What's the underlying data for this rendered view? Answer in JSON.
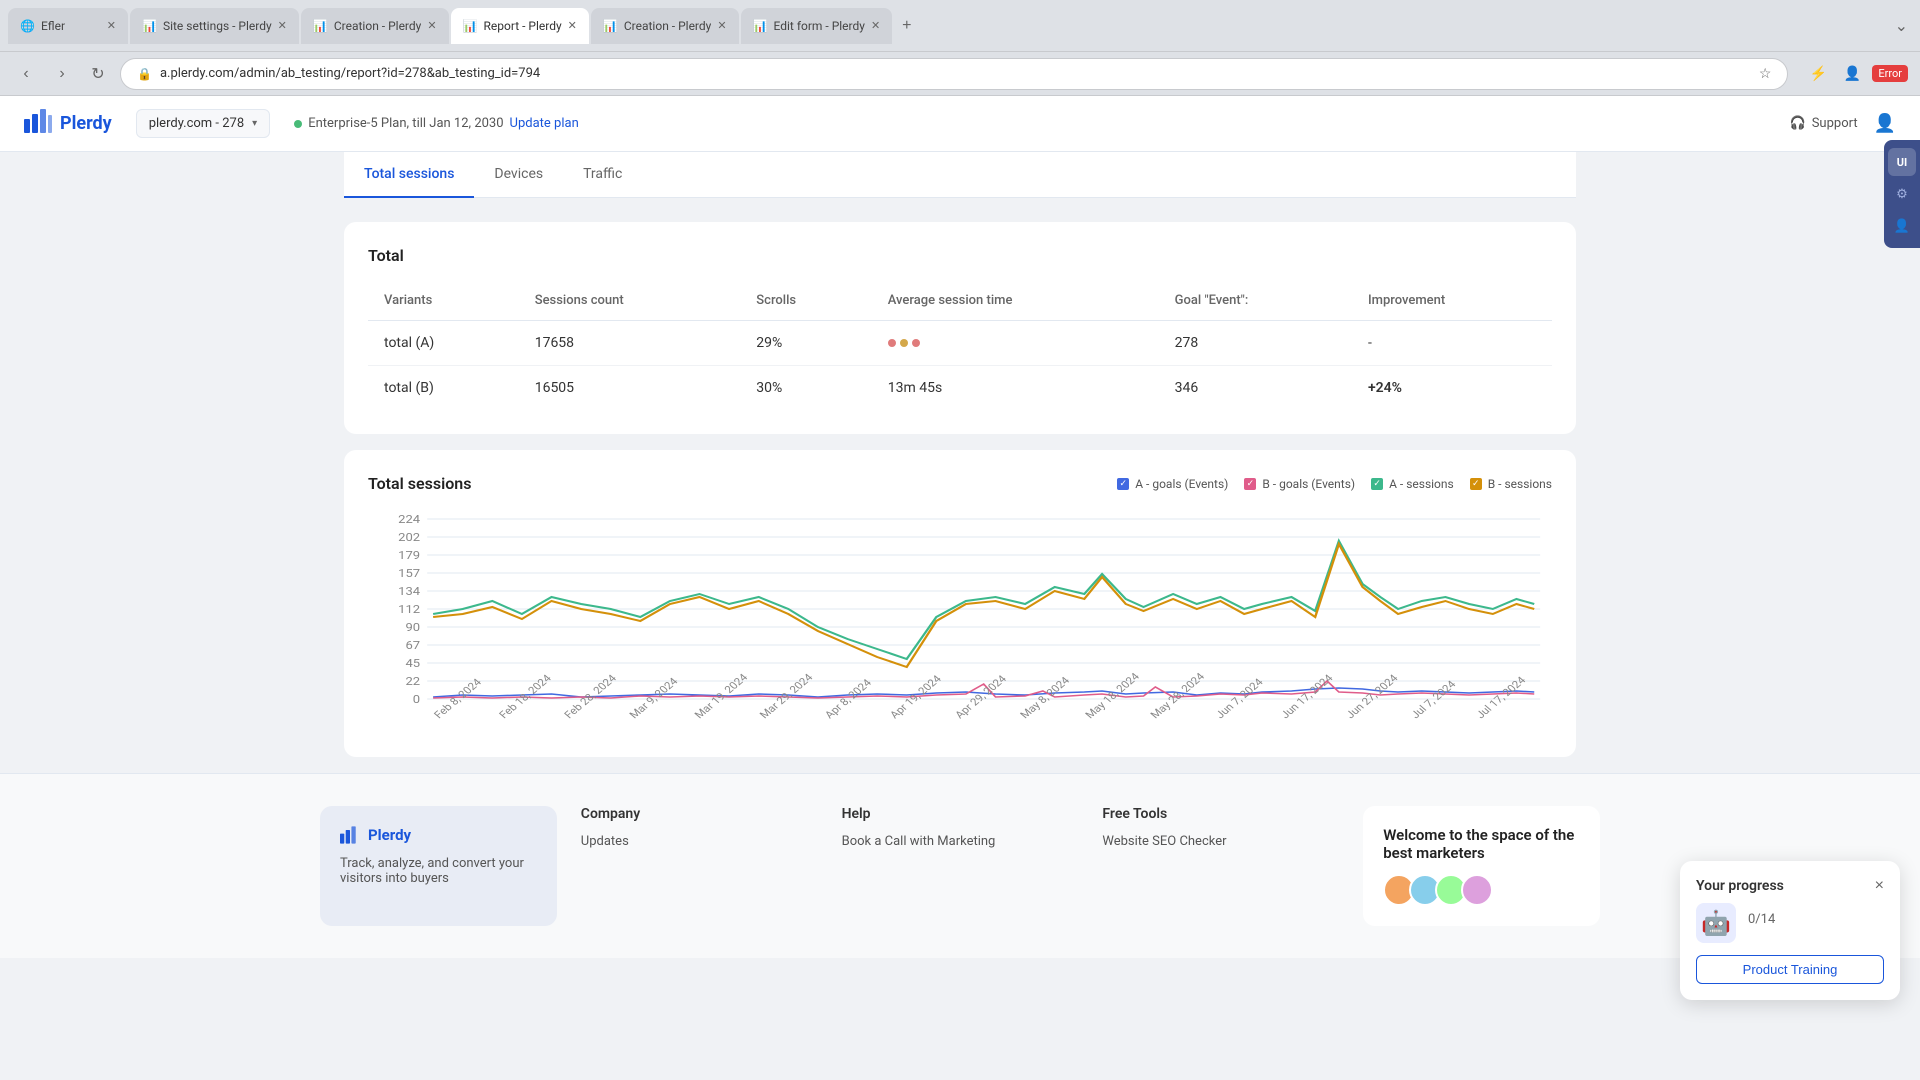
{
  "browser": {
    "tabs": [
      {
        "id": "efler",
        "label": "Efler",
        "active": false,
        "icon": "🌐"
      },
      {
        "id": "site-settings",
        "label": "Site settings - Plerdy",
        "active": false,
        "icon": "📊"
      },
      {
        "id": "creation1",
        "label": "Creation - Plerdy",
        "active": false,
        "icon": "📊"
      },
      {
        "id": "report",
        "label": "Report - Plerdy",
        "active": true,
        "icon": "📊"
      },
      {
        "id": "creation2",
        "label": "Creation - Plerdy",
        "active": false,
        "icon": "📊"
      },
      {
        "id": "edit-form",
        "label": "Edit form - Plerdy",
        "active": false,
        "icon": "📊"
      }
    ],
    "address": "a.plerdy.com/admin/ab_testing/report?id=278&ab_testing_id=794",
    "error_badge": "Error"
  },
  "header": {
    "logo_text": "Plerdy",
    "site_selector": "plerdy.com - 278",
    "plan_text": "Enterprise-5 Plan, till Jan 12, 2030",
    "update_plan": "Update plan",
    "support": "Support"
  },
  "tabs": [
    {
      "id": "total-sessions",
      "label": "Total sessions",
      "active": true
    },
    {
      "id": "devices",
      "label": "Devices",
      "active": false
    },
    {
      "id": "traffic",
      "label": "Traffic",
      "active": false
    }
  ],
  "table": {
    "section_title": "Total",
    "headers": [
      "Variants",
      "Sessions count",
      "Scrolls",
      "Average session time",
      "Goal \"Event\":",
      "Improvement"
    ],
    "rows": [
      {
        "variant": "total (A)",
        "sessions": "17658",
        "scrolls": "29%",
        "avg_time": "dots",
        "goal": "278",
        "improvement": "-",
        "dots": [
          "#e07b7b",
          "#d4a84b",
          "#e07b7b"
        ]
      },
      {
        "variant": "total (B)",
        "sessions": "16505",
        "scrolls": "30%",
        "avg_time": "13m 45s",
        "goal": "346",
        "improvement": "+24%",
        "improvement_class": "positive"
      }
    ]
  },
  "chart": {
    "title": "Total sessions",
    "legend": [
      {
        "id": "a-goals",
        "label": "A - goals (Events)",
        "color": "#4169e1",
        "type": "checkbox"
      },
      {
        "id": "b-goals",
        "label": "B - goals (Events)",
        "color": "#e05c8a",
        "type": "checkbox"
      },
      {
        "id": "a-sessions",
        "label": "A - sessions",
        "color": "#3cb88c",
        "type": "checkbox"
      },
      {
        "id": "b-sessions",
        "label": "B - sessions",
        "color": "#d4900a",
        "type": "checkbox"
      }
    ],
    "y_labels": [
      "224",
      "202",
      "179",
      "157",
      "134",
      "112",
      "90",
      "67",
      "45",
      "22",
      "0"
    ],
    "x_labels": [
      "Feb 8, 2024",
      "Feb 18, 2024",
      "Feb 28, 2024",
      "Mar 9, 2024",
      "Mar 19, 2024",
      "Mar 29, 2024",
      "Apr 8, 2024",
      "Apr 19, 2024",
      "Apr 29, 2024",
      "May 8, 2024",
      "May 18, 2024",
      "May 28, 2024",
      "Jun 7, 2024",
      "Jun 17, 2024",
      "Jun 27, 2024",
      "Jul 7, 2024",
      "Jul 17, 2024"
    ]
  },
  "right_panel": {
    "items": [
      {
        "id": "ui",
        "label": "UI",
        "active": true
      },
      {
        "id": "gear",
        "label": "⚙",
        "active": false
      },
      {
        "id": "person",
        "label": "👤",
        "active": false
      }
    ]
  },
  "footer": {
    "track_card": {
      "title": "Track, analyze, and convert your visitors into buyers"
    },
    "company": {
      "title": "Company",
      "links": [
        "Updates"
      ]
    },
    "help": {
      "title": "Help",
      "links": [
        "Book a Call with Marketing"
      ]
    },
    "free_tools": {
      "title": "Free Tools",
      "links": [
        "Website SEO Checker"
      ]
    },
    "community": {
      "title": "Welcome to the space of the best marketers"
    }
  },
  "progress_widget": {
    "title": "Your progress",
    "score": "0/14",
    "cta": "Product Training",
    "close": "×"
  }
}
